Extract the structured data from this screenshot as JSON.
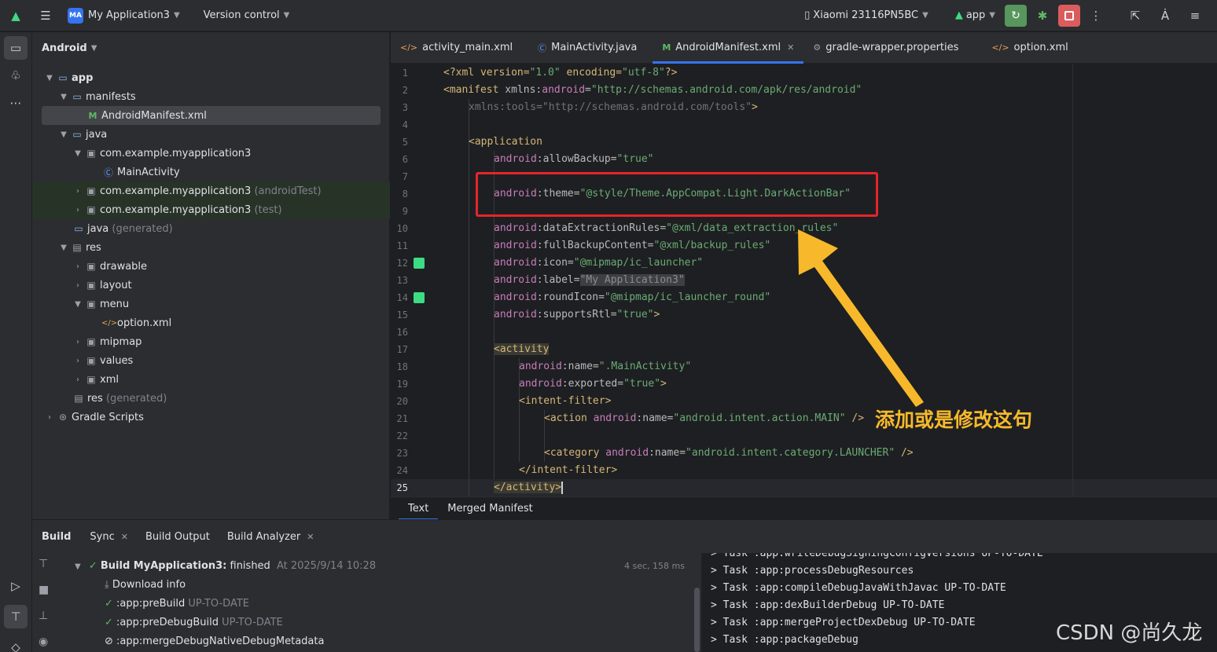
{
  "titlebar": {
    "project_badge": "MA",
    "project_name": "My Application3",
    "vcs": "Version control",
    "device": "Xiaomi 23116PN5BC",
    "run_config": "app"
  },
  "sidebar": {
    "view": "Android"
  },
  "tree": [
    {
      "label": "app",
      "extra": ""
    },
    {
      "label": "manifests",
      "extra": ""
    },
    {
      "label": "AndroidManifest.xml",
      "extra": ""
    },
    {
      "label": "java",
      "extra": ""
    },
    {
      "label": "com.example.myapplication3",
      "extra": ""
    },
    {
      "label": "MainActivity",
      "extra": ""
    },
    {
      "label": "com.example.myapplication3",
      "extra": "(androidTest)"
    },
    {
      "label": "com.example.myapplication3",
      "extra": "(test)"
    },
    {
      "label": "java",
      "extra": "(generated)"
    },
    {
      "label": "res",
      "extra": ""
    },
    {
      "label": "drawable",
      "extra": ""
    },
    {
      "label": "layout",
      "extra": ""
    },
    {
      "label": "menu",
      "extra": ""
    },
    {
      "label": "option.xml",
      "extra": ""
    },
    {
      "label": "mipmap",
      "extra": ""
    },
    {
      "label": "values",
      "extra": ""
    },
    {
      "label": "xml",
      "extra": ""
    },
    {
      "label": "res",
      "extra": "(generated)"
    },
    {
      "label": "Gradle Scripts",
      "extra": ""
    }
  ],
  "tabs": [
    {
      "label": "activity_main.xml"
    },
    {
      "label": "MainActivity.java"
    },
    {
      "label": "AndroidManifest.xml"
    },
    {
      "label": "gradle-wrapper.properties"
    },
    {
      "label": "option.xml"
    }
  ],
  "editor": {
    "line_numbers": [
      "1",
      "2",
      "3",
      "4",
      "5",
      "6",
      "7",
      "8",
      "9",
      "10",
      "11",
      "12",
      "13",
      "14",
      "15",
      "16",
      "17",
      "18",
      "19",
      "20",
      "21",
      "22",
      "23",
      "24",
      "25"
    ],
    "lines": {
      "l1_a": "<?xml version=",
      "l1_b": "\"1.0\"",
      "l1_c": " encoding=",
      "l1_d": "\"utf-8\"",
      "l1_e": "?>",
      "l2_a": "<manifest ",
      "l2_b": "xmlns:",
      "l2_c": "android",
      "l2_d": "=",
      "l2_e": "\"http://schemas.android.com/apk/res/android\"",
      "l3_a": "xmlns:tools=\"http://schemas.android.com/tools\"",
      "l3_b": ">",
      "l5": "<application",
      "l6_ns": "android",
      "l6_attr": ":allowBackup=",
      "l6_val": "\"true\"",
      "l8_ns": "android",
      "l8_attr": ":theme=",
      "l8_val": "\"@style/Theme.AppCompat.Light.DarkActionBar\"",
      "l10_ns": "android",
      "l10_attr": ":dataExtractionRules=",
      "l10_val": "\"@xml/data_extraction_rules\"",
      "l11_ns": "android",
      "l11_attr": ":fullBackupContent=",
      "l11_val": "\"@xml/backup_rules\"",
      "l12_ns": "android",
      "l12_attr": ":icon=",
      "l12_val": "\"@mipmap/ic_launcher\"",
      "l13_ns": "android",
      "l13_attr": ":label=",
      "l13_val": "\"My Application3\"",
      "l14_ns": "android",
      "l14_attr": ":roundIcon=",
      "l14_val": "\"@mipmap/ic_launcher_round\"",
      "l15_ns": "android",
      "l15_attr": ":supportsRtl=",
      "l15_val": "\"true\"",
      "l15_end": ">",
      "l17": "<activity",
      "l18_ns": "android",
      "l18_attr": ":name=",
      "l18_val": "\".MainActivity\"",
      "l19_ns": "android",
      "l19_attr": ":exported=",
      "l19_val": "\"true\"",
      "l19_end": ">",
      "l20": "<intent-filter>",
      "l21_a": "<action ",
      "l21_ns": "android",
      "l21_attr": ":name=",
      "l21_val": "\"android.intent.action.MAIN\"",
      "l21_end": " />",
      "l23_a": "<category ",
      "l23_ns": "android",
      "l23_attr": ":name=",
      "l23_val": "\"android.intent.category.LAUNCHER\"",
      "l23_end": " />",
      "l24": "</intent-filter>",
      "l25": "</activity>"
    },
    "annotation": "添加或是修改这句"
  },
  "subtabs": [
    {
      "label": "Text"
    },
    {
      "label": "Merged Manifest"
    }
  ],
  "build": {
    "title": "Build",
    "tabs": [
      {
        "label": "Sync"
      },
      {
        "label": "Build Output"
      },
      {
        "label": "Build Analyzer"
      }
    ],
    "tree": {
      "root_label": "Build MyApplication3:",
      "root_status": " finished",
      "root_time": "At 2025/9/14 10:28",
      "duration": "4 sec, 158 ms",
      "download": "Download info",
      "items": [
        {
          "task": ":app:preBuild",
          "status": "UP-TO-DATE"
        },
        {
          "task": ":app:preDebugBuild",
          "status": "UP-TO-DATE"
        },
        {
          "task": ":app:mergeDebugNativeDebugMetadata",
          "status": ""
        }
      ]
    },
    "log": [
      "> Task :app:writeDebugSigningConfigVersions UP-TO-DATE",
      "> Task :app:processDebugResources",
      "> Task :app:compileDebugJavaWithJavac UP-TO-DATE",
      "> Task :app:dexBuilderDebug UP-TO-DATE",
      "> Task :app:mergeProjectDexDebug UP-TO-DATE",
      "> Task :app:packageDebug"
    ]
  },
  "watermark": "CSDN @尚久龙"
}
